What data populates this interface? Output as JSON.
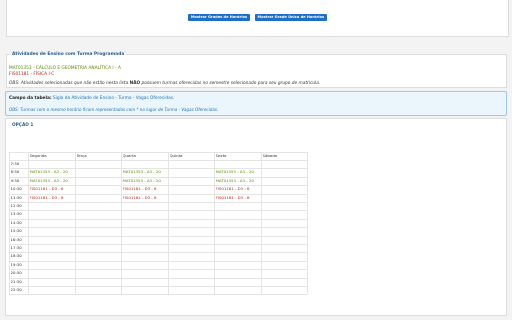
{
  "buttons": {
    "grades_horarios": "Mostrar Grades de Horários",
    "grade_unica": "Mostrar Grade Única de Horários"
  },
  "activities": {
    "legend": "Atividades de Ensino com Turma Programada",
    "items": [
      {
        "text": "MAT01353 - CÁLCULO E GEOMETRIA ANALÍTICA I - A",
        "color": "#5b8a00"
      },
      {
        "text": "FIS01181 - FÍSICA I-C",
        "color": "#c0241c"
      }
    ],
    "obs_prefix": "OBS: Atividades selecionadas que não estão nesta lista ",
    "obs_bold": "NÃO",
    "obs_suffix": " possuem turmas oferecidas no semestre selecionado para seu grupo de matrícula."
  },
  "info": {
    "label": "Campo da tabela:",
    "text": " Sigla da Atividade de Ensino - Turma - Vagas Oferecidas.",
    "note": "OBS: Turmas com o mesmo horário ficam representadas com * no lugar de Turma - Vagas Oferecidas."
  },
  "option_label": "OPÇÃO 1",
  "schedule": {
    "days": [
      "Segunda",
      "Terça",
      "Quarta",
      "Quinta",
      "Sexta",
      "Sábado"
    ],
    "times": [
      "7:30",
      "8:30",
      "9:30",
      "10:30",
      "11:30",
      "12:30",
      "13:30",
      "14:30",
      "15:30",
      "16:30",
      "17:30",
      "18:30",
      "19:30",
      "20:30",
      "21:30",
      "22:30"
    ],
    "entries": [
      {
        "time": "8:30",
        "day": "Segunda",
        "text": "MAT01353 - A3 - 20",
        "color": "#5b8a00"
      },
      {
        "time": "8:30",
        "day": "Quarta",
        "text": "MAT01353 - A3 - 20",
        "color": "#5b8a00"
      },
      {
        "time": "8:30",
        "day": "Sexta",
        "text": "MAT01353 - A3 - 20",
        "color": "#5b8a00"
      },
      {
        "time": "9:30",
        "day": "Segunda",
        "text": "MAT01353 - A3 - 20",
        "color": "#5b8a00"
      },
      {
        "time": "9:30",
        "day": "Quarta",
        "text": "MAT01353 - A3 - 20",
        "color": "#5b8a00"
      },
      {
        "time": "9:30",
        "day": "Sexta",
        "text": "MAT01353 - A3 - 20",
        "color": "#5b8a00"
      },
      {
        "time": "10:30",
        "day": "Segunda",
        "text": "FIS01181 - D3 - 6",
        "color": "#c0241c"
      },
      {
        "time": "10:30",
        "day": "Quarta",
        "text": "FIS01181 - D3 - 6",
        "color": "#c0241c"
      },
      {
        "time": "10:30",
        "day": "Sexta",
        "text": "FIS01181 - D3 - 6",
        "color": "#c0241c"
      },
      {
        "time": "11:30",
        "day": "Segunda",
        "text": "FIS01181 - D3 - 6",
        "color": "#c0241c"
      },
      {
        "time": "11:30",
        "day": "Quarta",
        "text": "FIS01181 - D3 - 6",
        "color": "#c0241c"
      },
      {
        "time": "11:30",
        "day": "Sexta",
        "text": "FIS01181 - D3 - 6",
        "color": "#c0241c"
      }
    ]
  }
}
